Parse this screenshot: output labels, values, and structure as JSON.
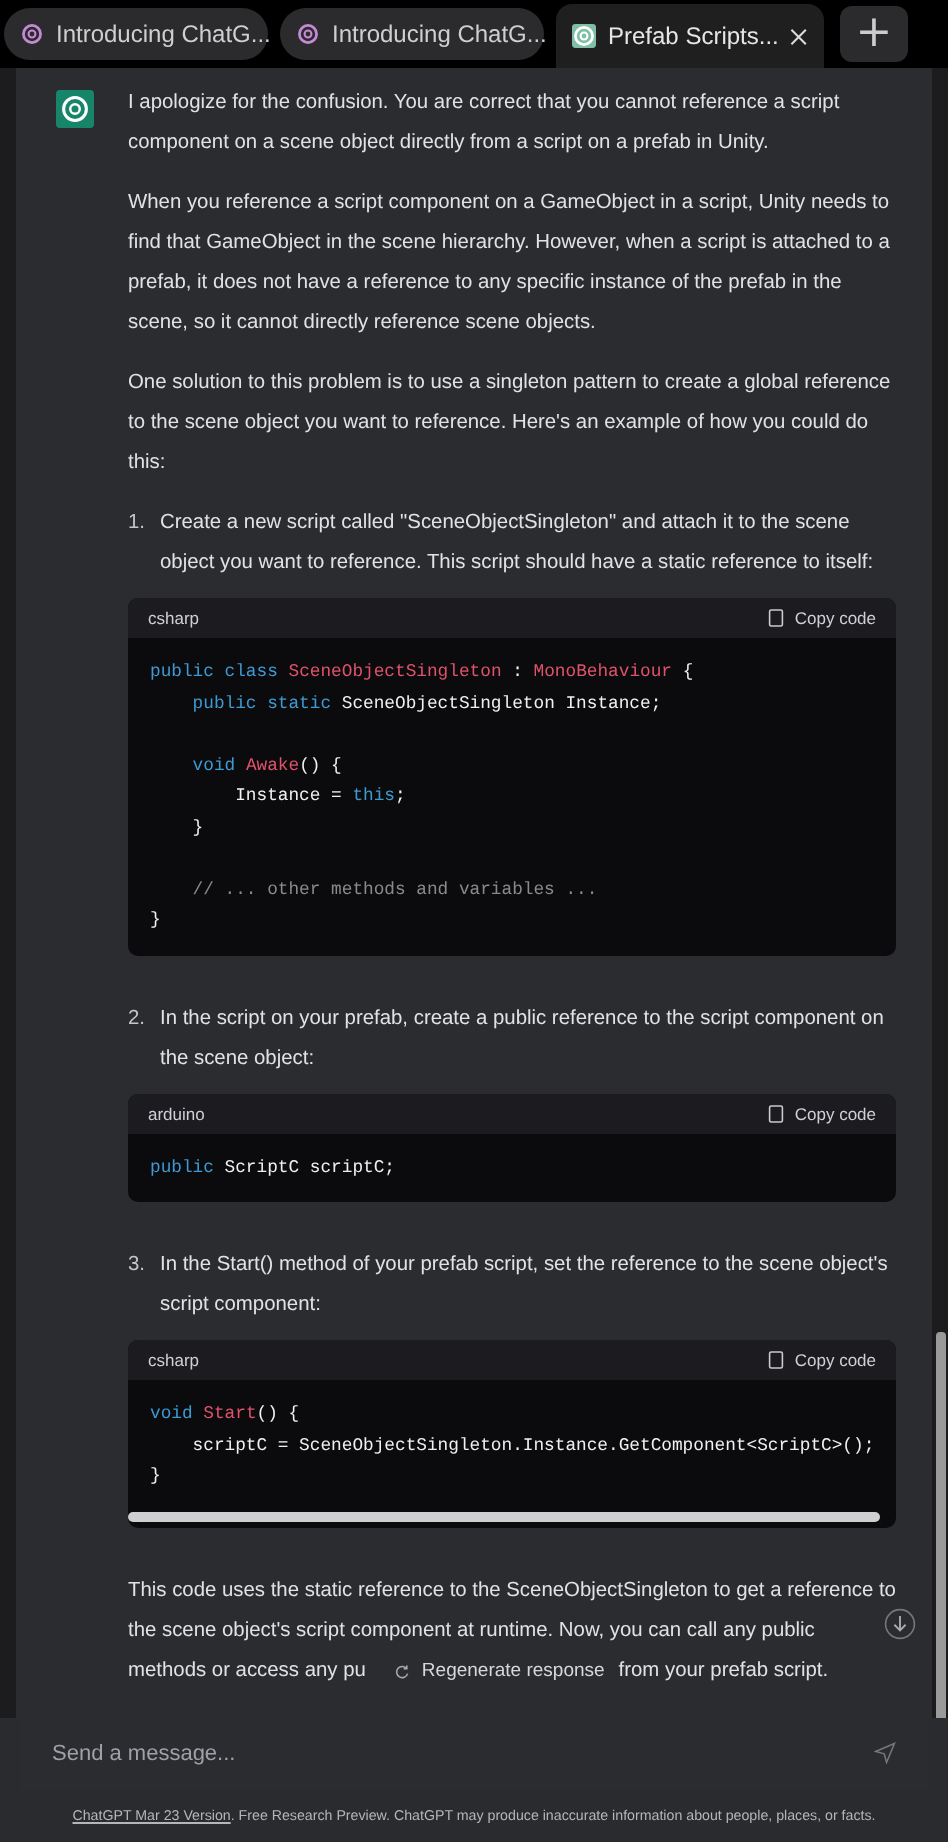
{
  "tabs": [
    {
      "title": "Introducing ChatG...",
      "selected": false
    },
    {
      "title": "Introducing ChatG...",
      "selected": false
    },
    {
      "title": "Prefab Scripts...",
      "selected": true
    }
  ],
  "new_tab": "+",
  "message": {
    "blocks": [
      {
        "kind": "para",
        "text": "I apologize for the confusion. You are correct that you cannot reference a script component on a scene object directly from a script on a prefab in Unity."
      },
      {
        "kind": "para",
        "text": "When you reference a script component on a GameObject in a script, Unity needs to find that GameObject in the scene hierarchy. However, when a script is attached to a prefab, it does not have a reference to any specific instance of the prefab in the scene, so it cannot directly reference scene objects."
      },
      {
        "kind": "para",
        "text": "One solution to this problem is to use a singleton pattern to create a global reference to the scene object you want to reference. Here's an example of how you could do this:"
      },
      {
        "kind": "step",
        "number": "1.",
        "text": "Create a new script called \"SceneObjectSingleton\" and attach it to the scene object you want to reference. This script should have a static reference to itself:"
      },
      {
        "kind": "code",
        "language": "csharp",
        "copy": "Copy code",
        "scrollbar": false,
        "lines": [
          {
            "gap_before": false,
            "tokens": [
              {
                "kind": "kw",
                "s": "public class "
              },
              {
                "kind": "type",
                "s": "SceneObjectSingleton"
              },
              {
                "kind": "plain",
                "s": " : "
              },
              {
                "kind": "type",
                "s": "MonoBehaviour"
              },
              {
                "kind": "plain",
                "s": " {"
              }
            ]
          },
          {
            "gap_before": false,
            "tokens": [
              {
                "kind": "kw",
                "s": "    public static "
              },
              {
                "kind": "plain",
                "s": "SceneObjectSingleton Instance;"
              }
            ]
          },
          {
            "gap_before": true,
            "tokens": [
              {
                "kind": "kw",
                "s": "    void "
              },
              {
                "kind": "type",
                "s": "Awake"
              },
              {
                "kind": "plain",
                "s": "() {"
              }
            ]
          },
          {
            "gap_before": false,
            "tokens": [
              {
                "kind": "plain",
                "s": "        Instance = "
              },
              {
                "kind": "kw",
                "s": "this"
              },
              {
                "kind": "plain",
                "s": ";"
              }
            ]
          },
          {
            "gap_before": false,
            "tokens": [
              {
                "kind": "plain",
                "s": "    }"
              }
            ]
          },
          {
            "gap_before": true,
            "tokens": [
              {
                "kind": "comment",
                "s": "    // ... other methods and variables ..."
              }
            ]
          },
          {
            "gap_before": false,
            "tokens": [
              {
                "kind": "plain",
                "s": "}"
              }
            ]
          }
        ]
      },
      {
        "kind": "step",
        "number": "2.",
        "text": "In the script on your prefab, create a public reference to the script component on the scene object:"
      },
      {
        "kind": "code",
        "language": "arduino",
        "copy": "Copy code",
        "scrollbar": false,
        "lines": [
          {
            "gap_before": false,
            "tokens": [
              {
                "kind": "kw",
                "s": "public "
              },
              {
                "kind": "plain",
                "s": "ScriptC scriptC;"
              }
            ]
          }
        ]
      },
      {
        "kind": "step",
        "number": "3.",
        "text": "In the Start() method of your prefab script, set the reference to the scene object's script component:"
      },
      {
        "kind": "code",
        "language": "csharp",
        "copy": "Copy code",
        "scrollbar": true,
        "lines": [
          {
            "gap_before": false,
            "tokens": [
              {
                "kind": "kw",
                "s": "void "
              },
              {
                "kind": "type",
                "s": "Start"
              },
              {
                "kind": "plain",
                "s": "() {"
              }
            ]
          },
          {
            "gap_before": false,
            "tokens": [
              {
                "kind": "plain",
                "s": "    scriptC = SceneObjectSingleton.Instance.GetComponent<ScriptC>();"
              }
            ]
          },
          {
            "gap_before": false,
            "tokens": [
              {
                "kind": "plain",
                "s": "}"
              }
            ]
          }
        ]
      },
      {
        "kind": "last",
        "text": "This code uses the static reference to the SceneObjectSingleton to get a reference to the scene object's script component at runtime. Now, you can call any public",
        "line3": "methods or access any pu",
        "tail": "from your prefab script."
      }
    ]
  },
  "regenerate": "Regenerate response",
  "composer": {
    "placeholder": "Send a message..."
  },
  "footer": {
    "link": "ChatGPT Mar 23 Version",
    "text": ". Free Research Preview. ChatGPT may produce inaccurate information about people, places, or facts."
  }
}
